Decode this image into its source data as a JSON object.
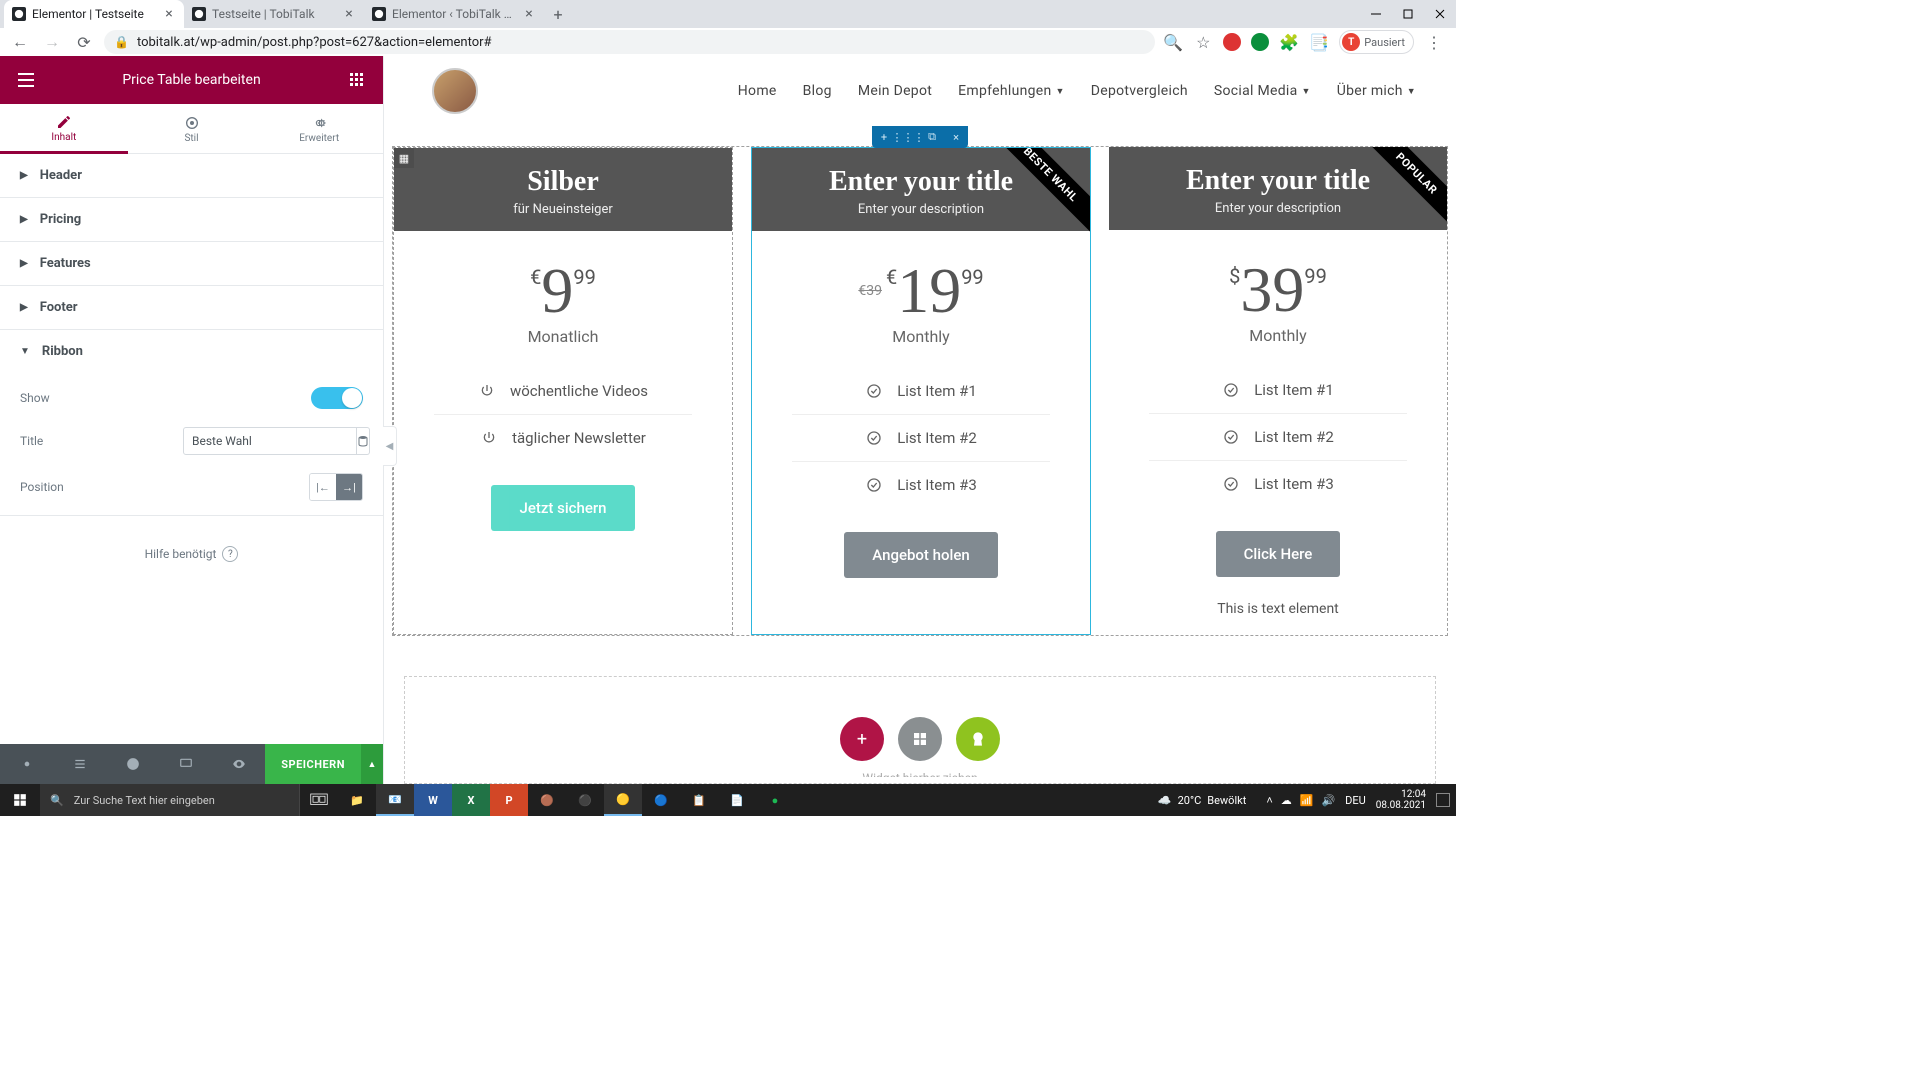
{
  "browser": {
    "tabs": [
      {
        "title": "Elementor | Testseite",
        "active": true
      },
      {
        "title": "Testseite | TobiTalk",
        "active": false
      },
      {
        "title": "Elementor ‹ TobiTalk — WordPre",
        "active": false
      }
    ],
    "url": "tobitalk.at/wp-admin/post.php?post=627&action=elementor#",
    "profile_label": "Pausiert",
    "profile_initial": "T"
  },
  "sidebar": {
    "title": "Price Table bearbeiten",
    "tabs": {
      "content": "Inhalt",
      "style": "Stil",
      "advanced": "Erweitert"
    },
    "sections": {
      "header": "Header",
      "pricing": "Pricing",
      "features": "Features",
      "footer": "Footer",
      "ribbon": "Ribbon"
    },
    "controls": {
      "show_label": "Show",
      "title_label": "Title",
      "title_value": "Beste Wahl",
      "position_label": "Position"
    },
    "help": "Hilfe benötigt",
    "save": "SPEICHERN"
  },
  "site_nav": [
    "Home",
    "Blog",
    "Mein Depot",
    "Empfehlungen",
    "Depotvergleich",
    "Social Media",
    "Über mich"
  ],
  "site_nav_dropdown": [
    false,
    false,
    false,
    true,
    false,
    true,
    true
  ],
  "cards": [
    {
      "title": "Silber",
      "subtitle": "für Neueinsteiger",
      "currency": "€",
      "price": "9",
      "cents": "99",
      "old_price": "",
      "period": "Monatlich",
      "features": [
        "wöchentliche Videos",
        "täglicher Newsletter"
      ],
      "cta": "Jetzt sichern",
      "ribbon": "",
      "footer_text": ""
    },
    {
      "title": "Enter your title",
      "subtitle": "Enter your description",
      "currency": "€",
      "price": "19",
      "cents": "99",
      "old_price": "€39",
      "period": "Monthly",
      "features": [
        "List Item #1",
        "List Item #2",
        "List Item #3"
      ],
      "cta": "Angebot holen",
      "ribbon": "BESTE WAHL",
      "footer_text": ""
    },
    {
      "title": "Enter your title",
      "subtitle": "Enter your description",
      "currency": "$",
      "price": "39",
      "cents": "99",
      "old_price": "",
      "period": "Monthly",
      "features": [
        "List Item #1",
        "List Item #2",
        "List Item #3"
      ],
      "cta": "Click Here",
      "ribbon": "POPULAR",
      "footer_text": "This is text element"
    }
  ],
  "empty_hint": "Widget hierher ziehen",
  "taskbar": {
    "search_placeholder": "Zur Suche Text hier eingeben",
    "weather_temp": "20°C",
    "weather_desc": "Bewölkt",
    "lang": "DEU",
    "time": "12:04",
    "date": "08.08.2021"
  }
}
